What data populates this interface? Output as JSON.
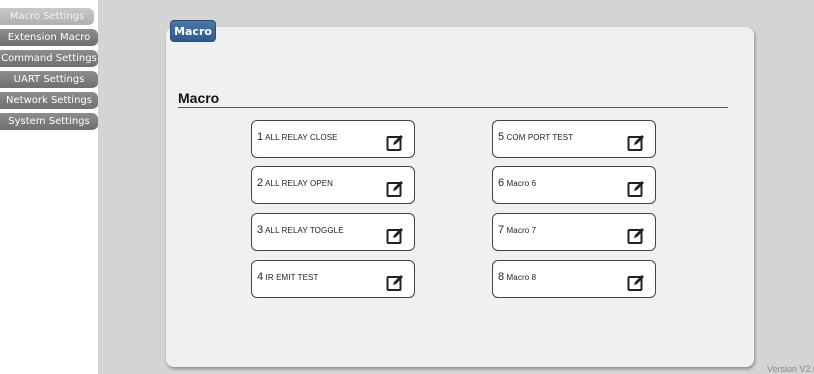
{
  "sidebar": {
    "items": [
      {
        "label": "Macro Settings",
        "active": true
      },
      {
        "label": "Extension Macro",
        "active": false
      },
      {
        "label": "Command Settings",
        "active": false
      },
      {
        "label": "UART Settings",
        "active": false
      },
      {
        "label": "Network Settings",
        "active": false
      },
      {
        "label": "System Settings",
        "active": false
      }
    ]
  },
  "panel": {
    "tab_label": "Macro",
    "section_title": "Macro"
  },
  "macros": [
    {
      "num": "1",
      "name": "ALL RELAY CLOSE"
    },
    {
      "num": "2",
      "name": "ALL RELAY OPEN"
    },
    {
      "num": "3",
      "name": "ALL RELAY TOGGLE"
    },
    {
      "num": "4",
      "name": "IR EMIT TEST"
    },
    {
      "num": "5",
      "name": "COM PORT TEST"
    },
    {
      "num": "6",
      "name": "Macro 6"
    },
    {
      "num": "7",
      "name": "Macro 7"
    },
    {
      "num": "8",
      "name": "Macro 8"
    }
  ],
  "footer": {
    "version": "Version V2.0"
  },
  "icons": {
    "edit": "edit-icon"
  },
  "colors": {
    "tab_blue": "#3a6699",
    "sidebar_gray": "#7d7d7d",
    "main_bg": "#d4d4d4"
  }
}
